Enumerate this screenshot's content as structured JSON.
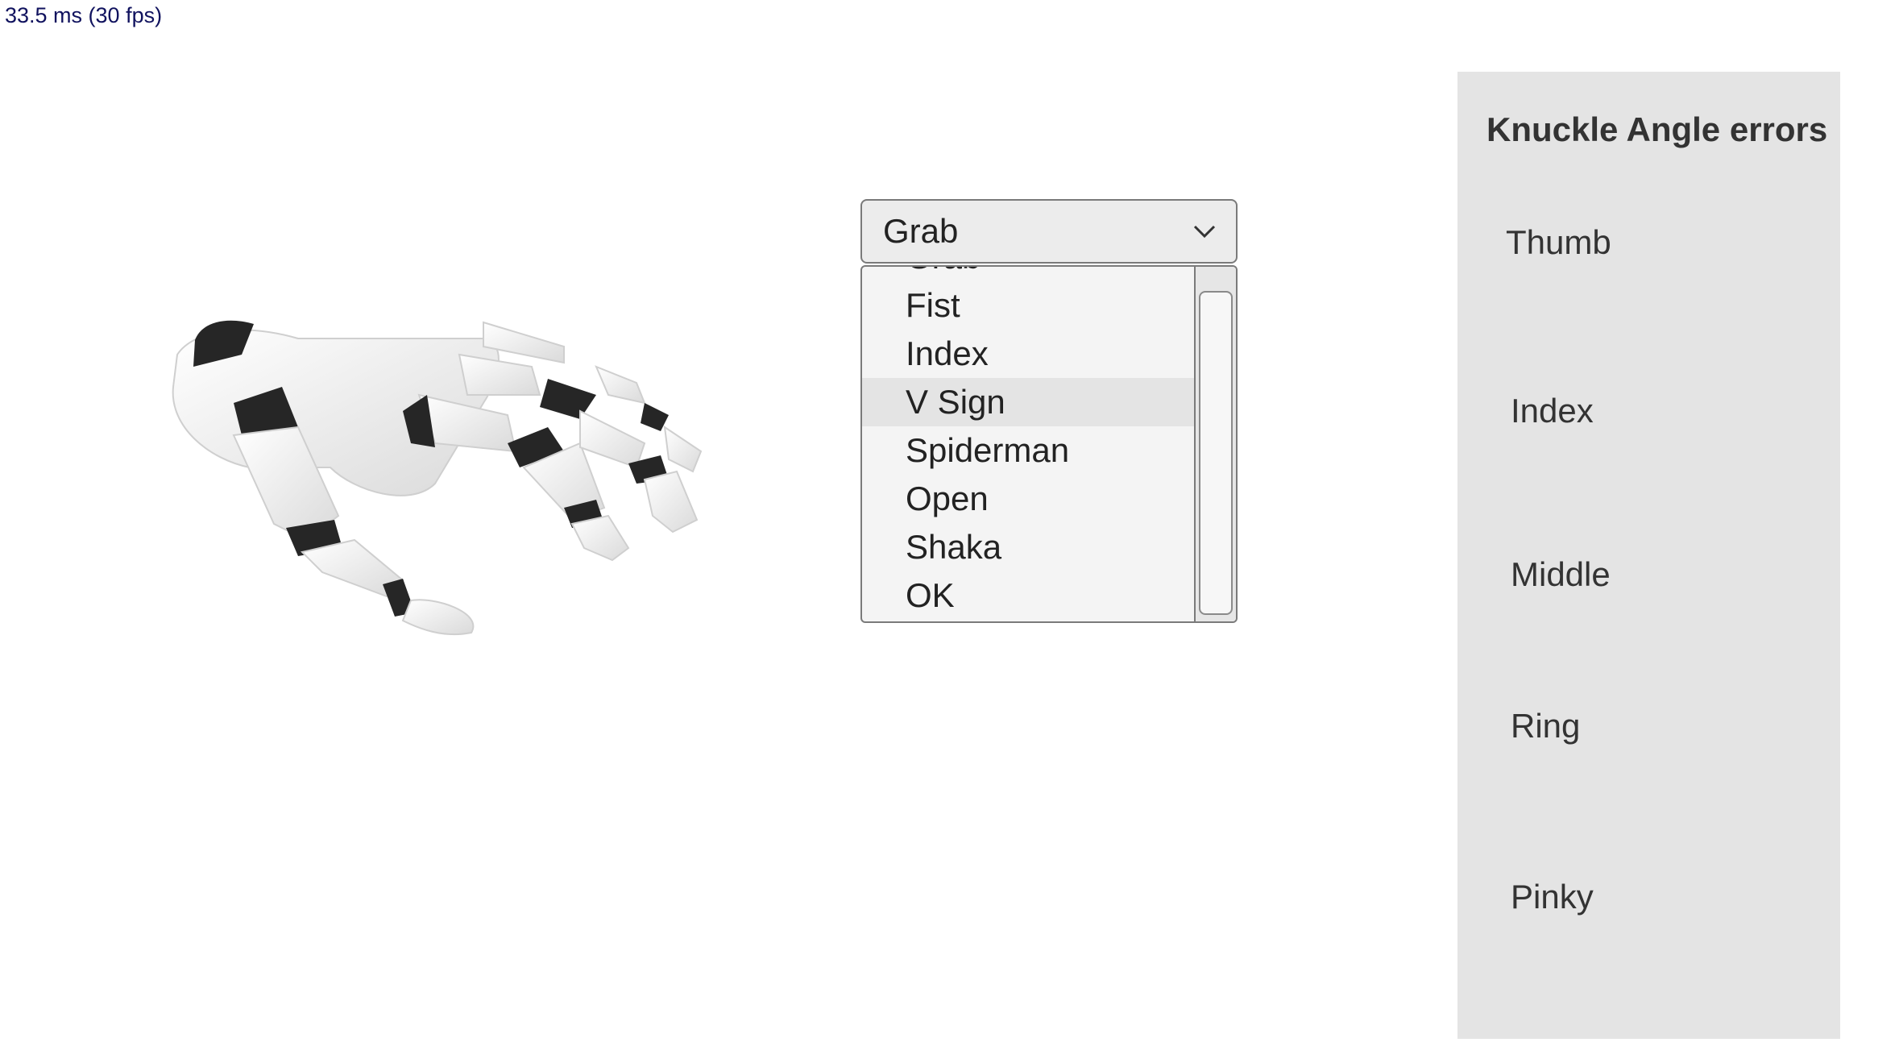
{
  "stats": {
    "fps_text": "33.5 ms (30 fps)"
  },
  "viewport": {
    "icon": "hand-model-icon"
  },
  "pose_select": {
    "selected": "Grab",
    "chevron_icon": "chevron-down-icon",
    "check_icon": "checkmark-icon",
    "options": [
      {
        "label": "Grab",
        "checked": true
      },
      {
        "label": "Fist"
      },
      {
        "label": "Index"
      },
      {
        "label": "V Sign",
        "highlighted": true
      },
      {
        "label": "Spiderman"
      },
      {
        "label": "Open"
      },
      {
        "label": "Shaka"
      },
      {
        "label": "OK"
      }
    ]
  },
  "panel": {
    "title": "Knuckle Angle errors",
    "fingers": [
      "Thumb",
      "Index",
      "Middle",
      "Ring",
      "Pinky"
    ],
    "background": "#e4e4e4"
  }
}
